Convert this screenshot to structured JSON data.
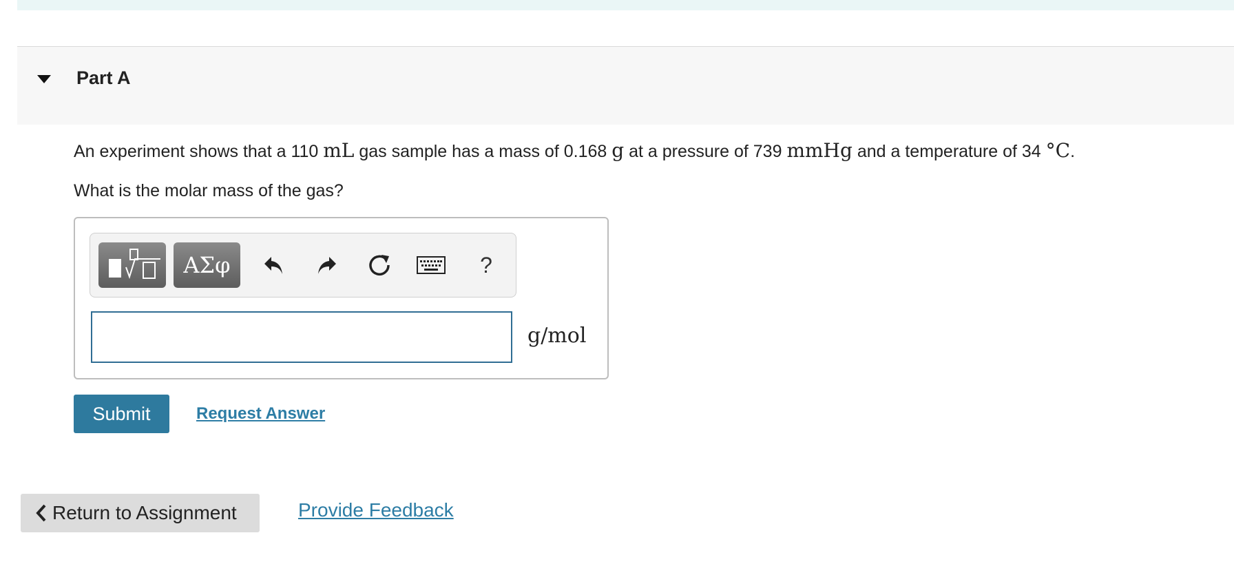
{
  "part": {
    "title": "Part A"
  },
  "question": {
    "t1": "An experiment shows that a 110 ",
    "u1": "mL",
    "t2": " gas sample has a mass of 0.168 ",
    "u2": "g",
    "t3": " at a pressure of 739 ",
    "u3": "mmHg",
    "t4": " and a temperature of 34 ",
    "u4": "°C",
    "t5": ".",
    "prompt": "What is the molar mass of the gas?"
  },
  "toolbar": {
    "greek_label": "ΑΣφ",
    "help_label": "?",
    "icons": [
      "templates-icon",
      "greek-letters-icon",
      "undo-icon",
      "redo-icon",
      "reset-icon",
      "keyboard-icon",
      "help-icon"
    ]
  },
  "answer": {
    "value": "",
    "unit": "g/mol"
  },
  "actions": {
    "submit_label": "Submit",
    "request_label": "Request Answer"
  },
  "footer": {
    "return_label": "Return to Assignment",
    "feedback_label": "Provide Feedback"
  },
  "colors": {
    "primary": "#2e7a9e",
    "link": "#2d7da5",
    "header_bg": "#f7f7f7",
    "top_strip": "#eaf6f6"
  }
}
